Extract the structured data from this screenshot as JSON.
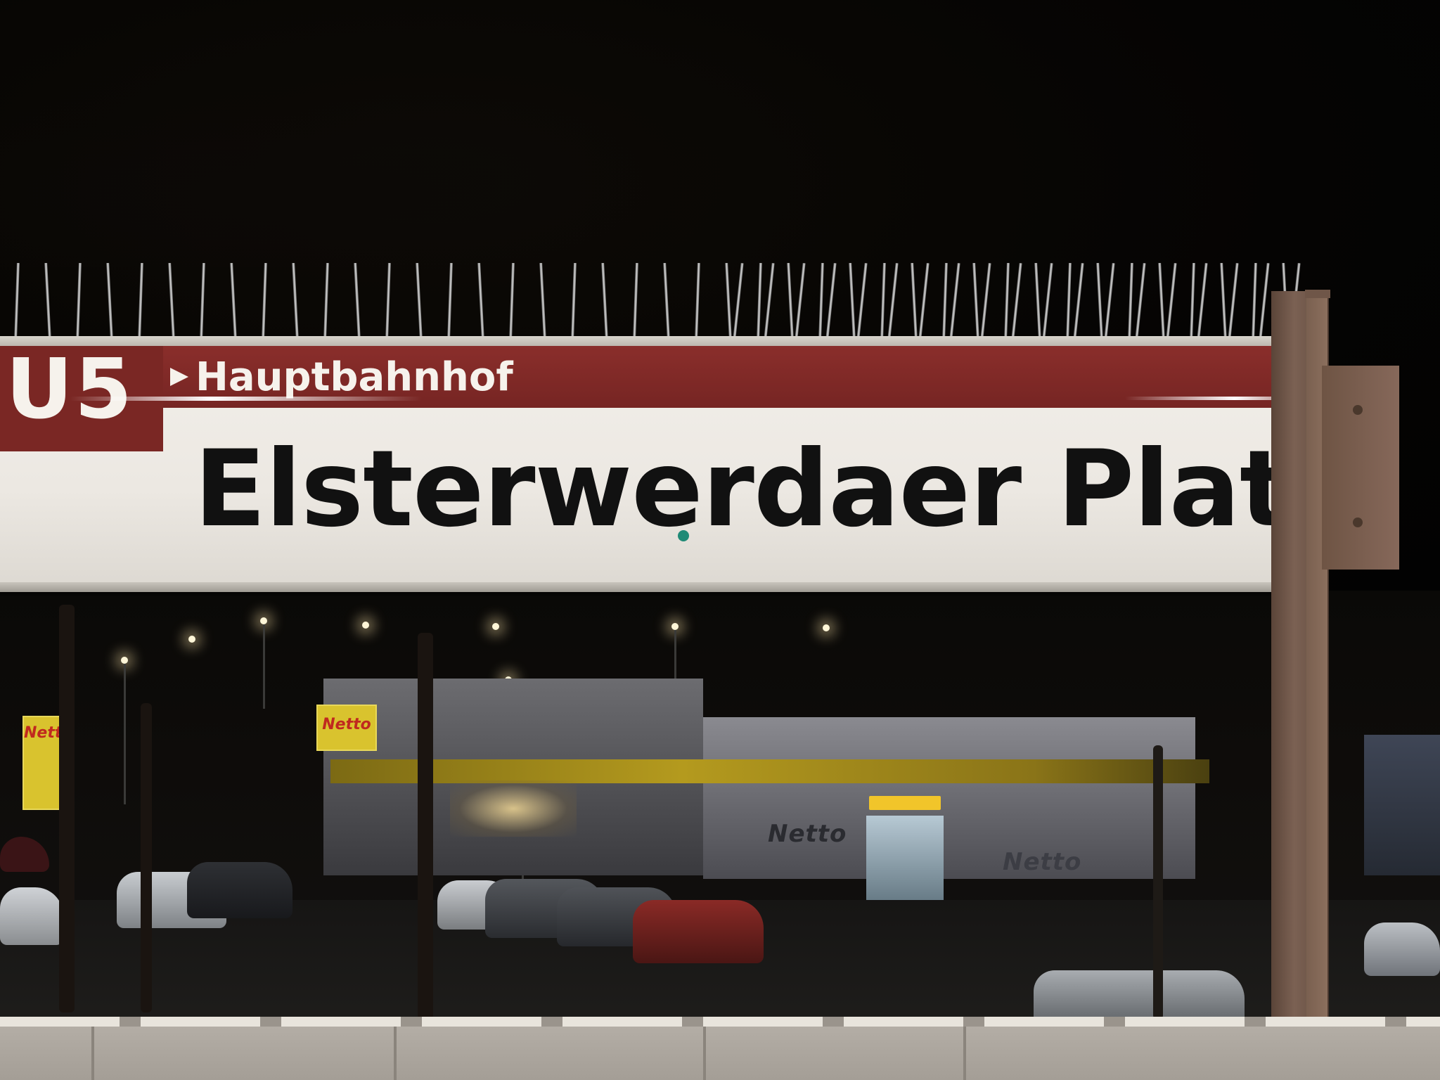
{
  "sign": {
    "line": "U5",
    "direction": "Hauptbahnhof",
    "station": "Elsterwerdaer Platz",
    "accent_color": "#7a2724",
    "marker_color": "#1f8a76"
  },
  "background": {
    "store_brand": "Netto"
  }
}
